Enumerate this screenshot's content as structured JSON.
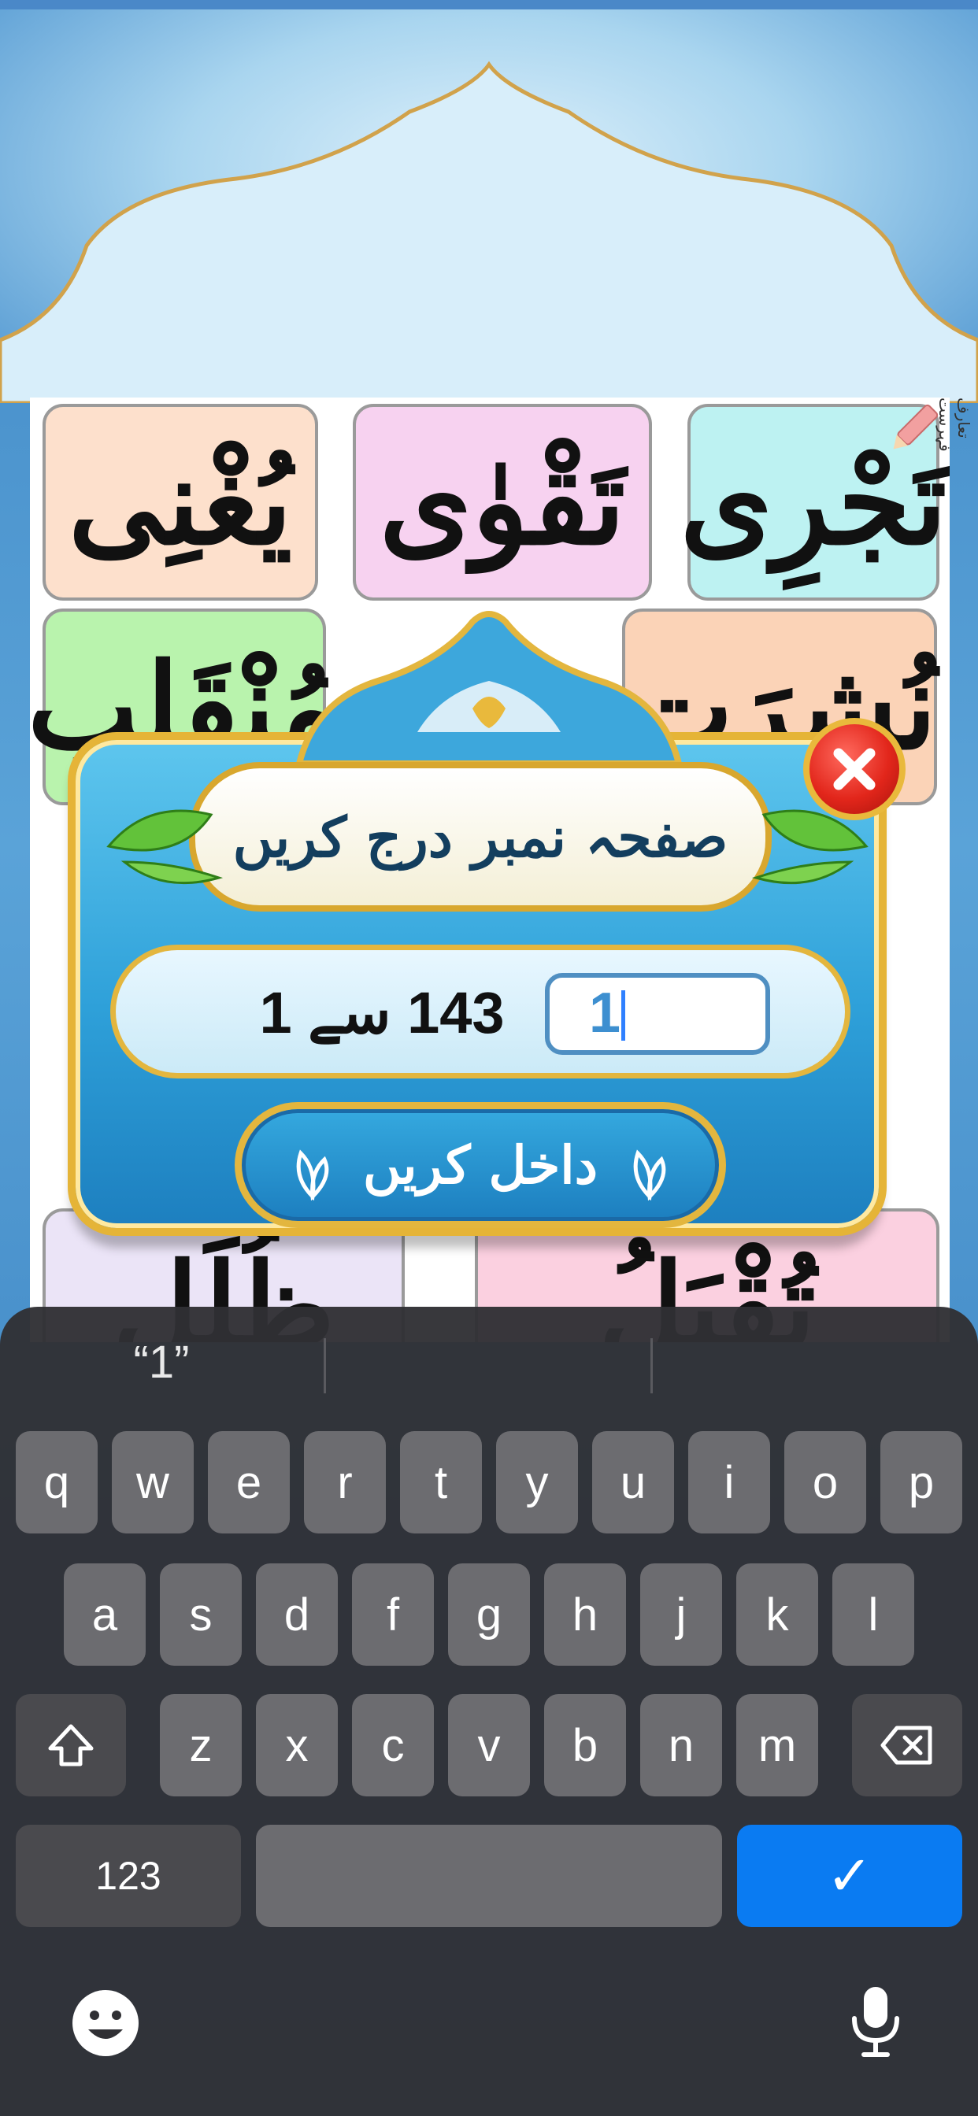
{
  "page": {
    "words": [
      {
        "text": "تَجْرِی",
        "bg": "#bdf2f2"
      },
      {
        "text": "تَقْوٰی",
        "bg": "#f7d2f0"
      },
      {
        "text": "يُغْنِی",
        "bg": "#fde0cc"
      },
      {
        "text": "نُشِرَت",
        "bg": "#fbd3b7"
      },
      {
        "text": "مُنْقَلِب",
        "bg": "#b9f3ad"
      },
      {
        "text": "تُقْبَلُ",
        "bg": "#fbd0e0"
      },
      {
        "text": "ظُلَل",
        "bg": "#ebe4f7"
      }
    ],
    "side_label": "تعارف فہرست"
  },
  "dialog": {
    "title": "صفحہ نمبر درج کریں",
    "range_text": "143 سے 1",
    "page_input_value": "1",
    "enter_label": "داخل کریں",
    "accent": "#e3b63e"
  },
  "keyboard": {
    "suggestion": "“1”",
    "row1": [
      "q",
      "w",
      "e",
      "r",
      "t",
      "y",
      "u",
      "i",
      "o",
      "p"
    ],
    "row2": [
      "a",
      "s",
      "d",
      "f",
      "g",
      "h",
      "j",
      "k",
      "l"
    ],
    "row3": [
      "z",
      "x",
      "c",
      "v",
      "b",
      "n",
      "m"
    ],
    "numbers_label": "123",
    "done_symbol": "✓"
  }
}
